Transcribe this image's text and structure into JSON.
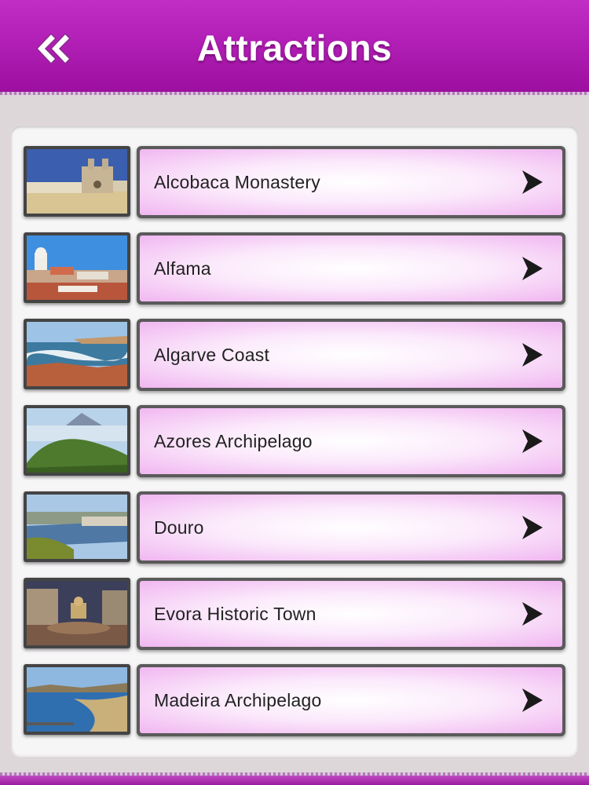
{
  "header": {
    "title": "Attractions",
    "back_icon": "double-chevron-left-icon"
  },
  "colors": {
    "navbar": "#b21fb6",
    "item_gradient_edge": "#f0b4f0",
    "background": "#ded7da"
  },
  "items": [
    {
      "label": "Alcobaca Monastery",
      "thumbnail": "monastery-photo",
      "icon": "chevron-right-icon"
    },
    {
      "label": "Alfama",
      "thumbnail": "alfama-photo",
      "icon": "chevron-right-icon"
    },
    {
      "label": "Algarve Coast",
      "thumbnail": "coast-photo",
      "icon": "chevron-right-icon"
    },
    {
      "label": "Azores Archipelago",
      "thumbnail": "azores-photo",
      "icon": "chevron-right-icon"
    },
    {
      "label": "Douro",
      "thumbnail": "douro-photo",
      "icon": "chevron-right-icon"
    },
    {
      "label": "Evora Historic Town",
      "thumbnail": "evora-photo",
      "icon": "chevron-right-icon"
    },
    {
      "label": "Madeira Archipelago",
      "thumbnail": "madeira-photo",
      "icon": "chevron-right-icon"
    }
  ]
}
